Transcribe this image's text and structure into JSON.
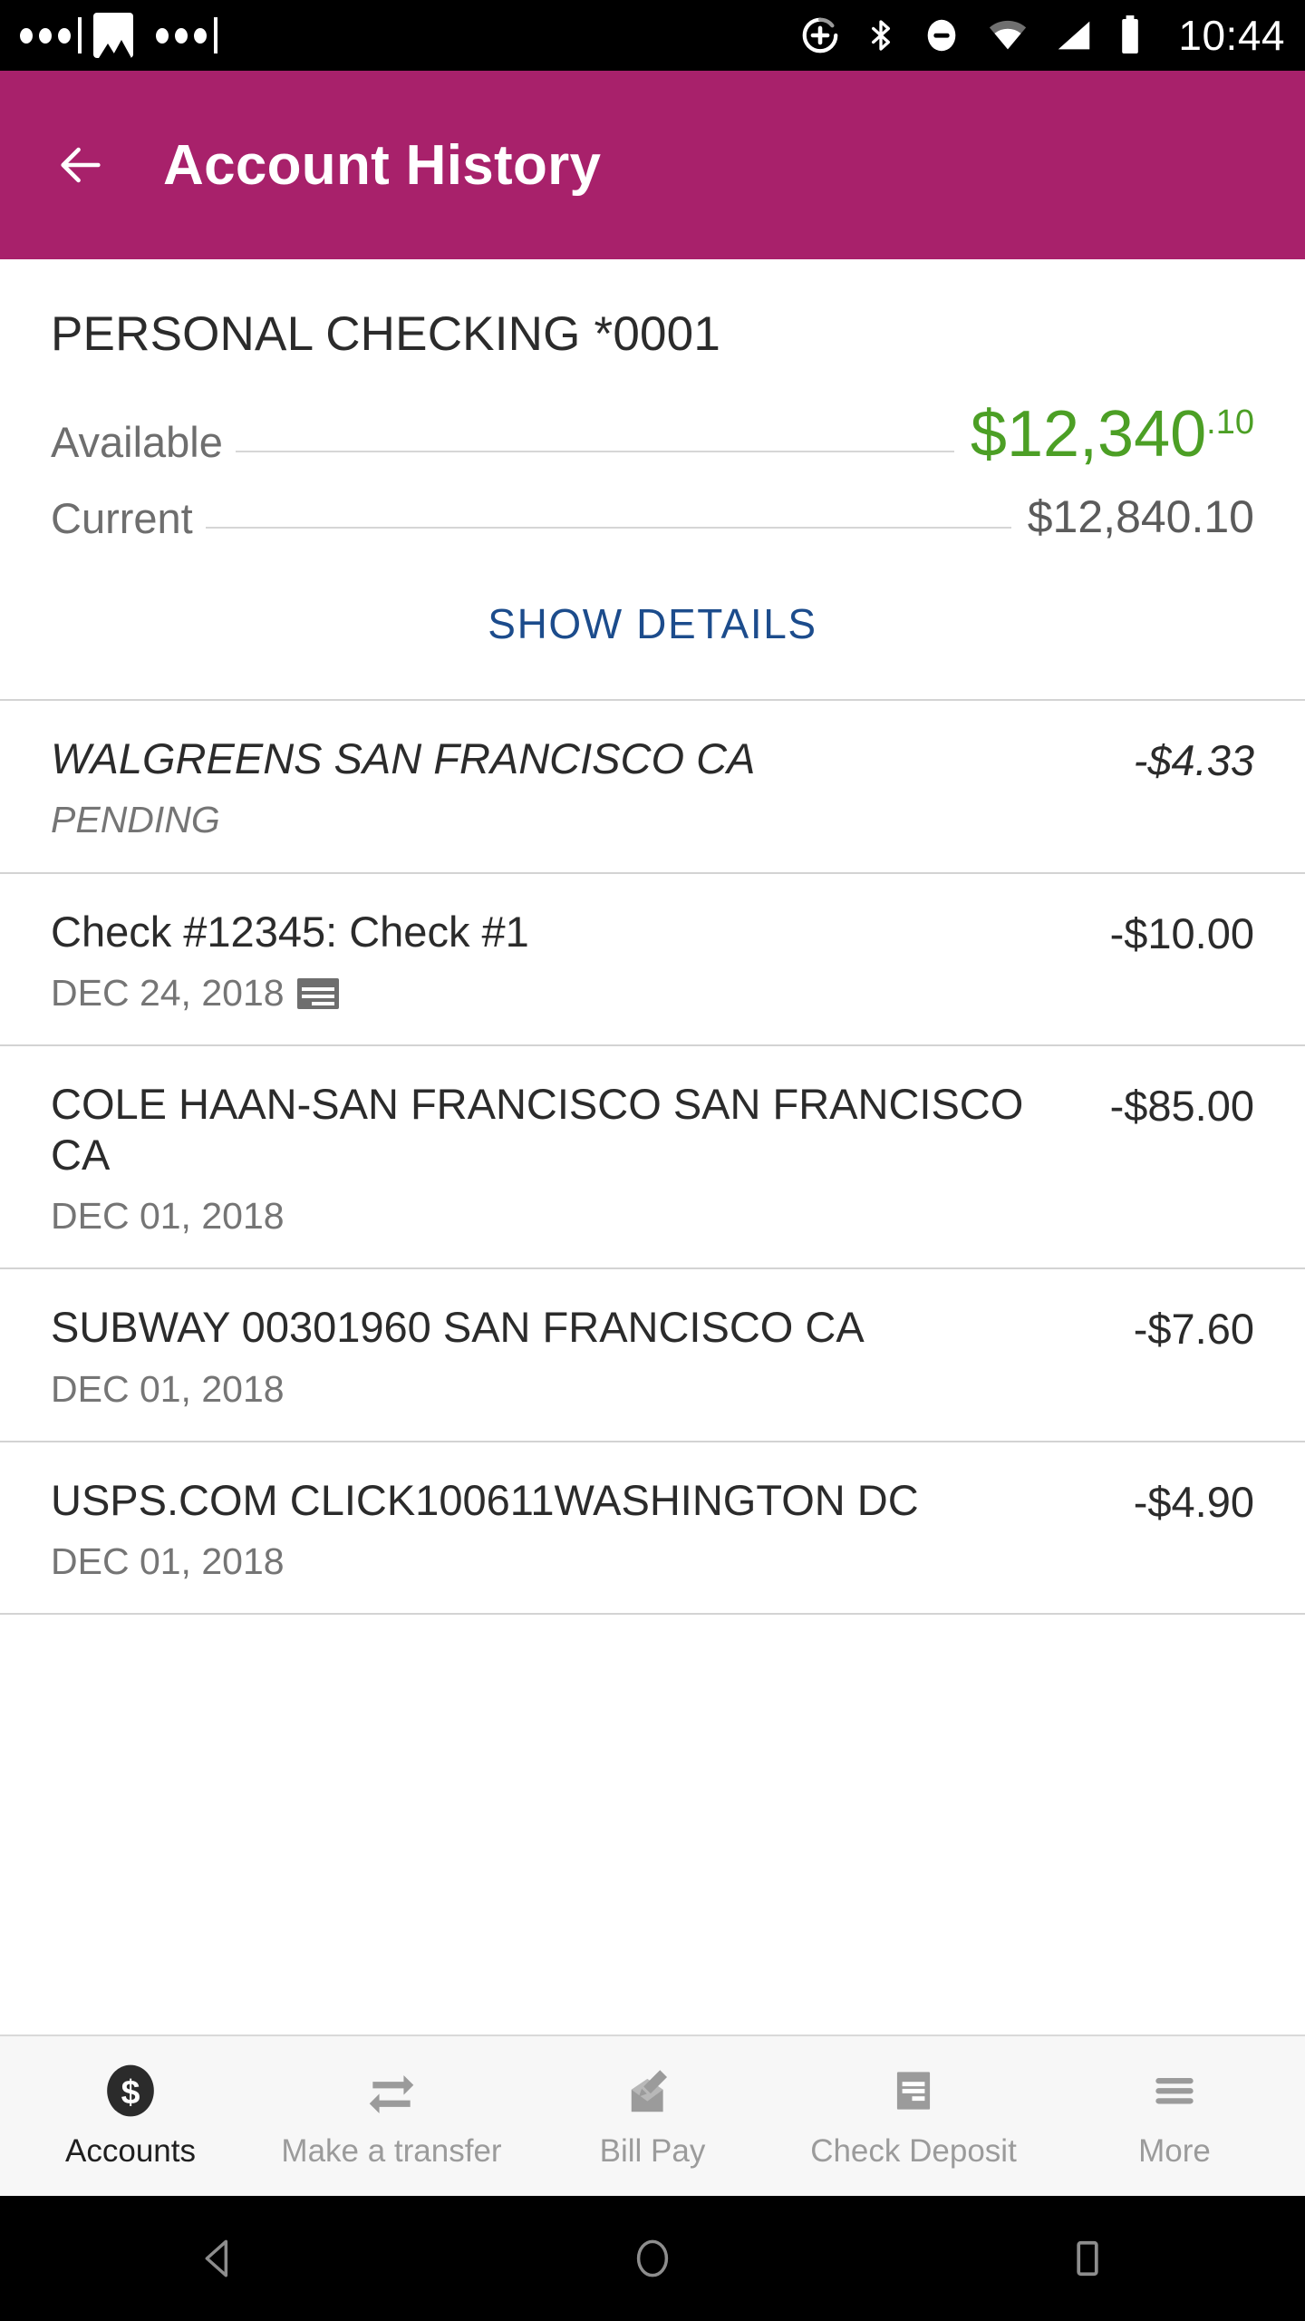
{
  "status_bar": {
    "time": "10:44",
    "icons": [
      "more-dots",
      "image-icon",
      "more-dots",
      "alarm-add-icon",
      "bluetooth-icon",
      "do-not-disturb-icon",
      "wifi-icon",
      "cellular-signal-icon",
      "battery-icon"
    ]
  },
  "app_bar": {
    "title": "Account History",
    "back_icon": "back-arrow-icon",
    "background_color": "#A8216B"
  },
  "account": {
    "name": "PERSONAL CHECKING *0001",
    "available_label": "Available",
    "available_amount": "$12,340",
    "available_cents": ".10",
    "available_color": "#4C9F25",
    "current_label": "Current",
    "current_amount": "$12,840.10",
    "show_details_label": "SHOW DETAILS",
    "show_details_color": "#1C4C8C"
  },
  "transactions": [
    {
      "title": "WALGREENS SAN FRANCISCO CA",
      "subtitle": "PENDING",
      "amount": "-$4.33",
      "pending": true,
      "icon": ""
    },
    {
      "title": "Check #12345: Check #1",
      "subtitle": "DEC 24, 2018",
      "amount": "-$10.00",
      "pending": false,
      "icon": "check-image-icon"
    },
    {
      "title": "COLE HAAN-SAN FRANCISCO SAN FRANCISCO CA",
      "subtitle": "DEC 01, 2018",
      "amount": "-$85.00",
      "pending": false,
      "icon": ""
    },
    {
      "title": "SUBWAY 00301960 SAN FRANCISCO CA",
      "subtitle": "DEC 01, 2018",
      "amount": "-$7.60",
      "pending": false,
      "icon": ""
    },
    {
      "title": "USPS.COM CLICK100611WASHINGTON DC",
      "subtitle": "DEC 01, 2018",
      "amount": "-$4.90",
      "pending": false,
      "icon": ""
    }
  ],
  "tab_bar": {
    "items": [
      {
        "label": "Accounts",
        "icon": "dollar-circle-icon",
        "active": true
      },
      {
        "label": "Make a transfer",
        "icon": "transfer-arrows-icon",
        "active": false
      },
      {
        "label": "Bill Pay",
        "icon": "envelope-pen-icon",
        "active": false
      },
      {
        "label": "Check Deposit",
        "icon": "check-document-icon",
        "active": false
      },
      {
        "label": "More",
        "icon": "hamburger-menu-icon",
        "active": false
      }
    ]
  },
  "android_nav": {
    "back": "nav-back-icon",
    "home": "nav-home-icon",
    "recents": "nav-recents-icon"
  }
}
